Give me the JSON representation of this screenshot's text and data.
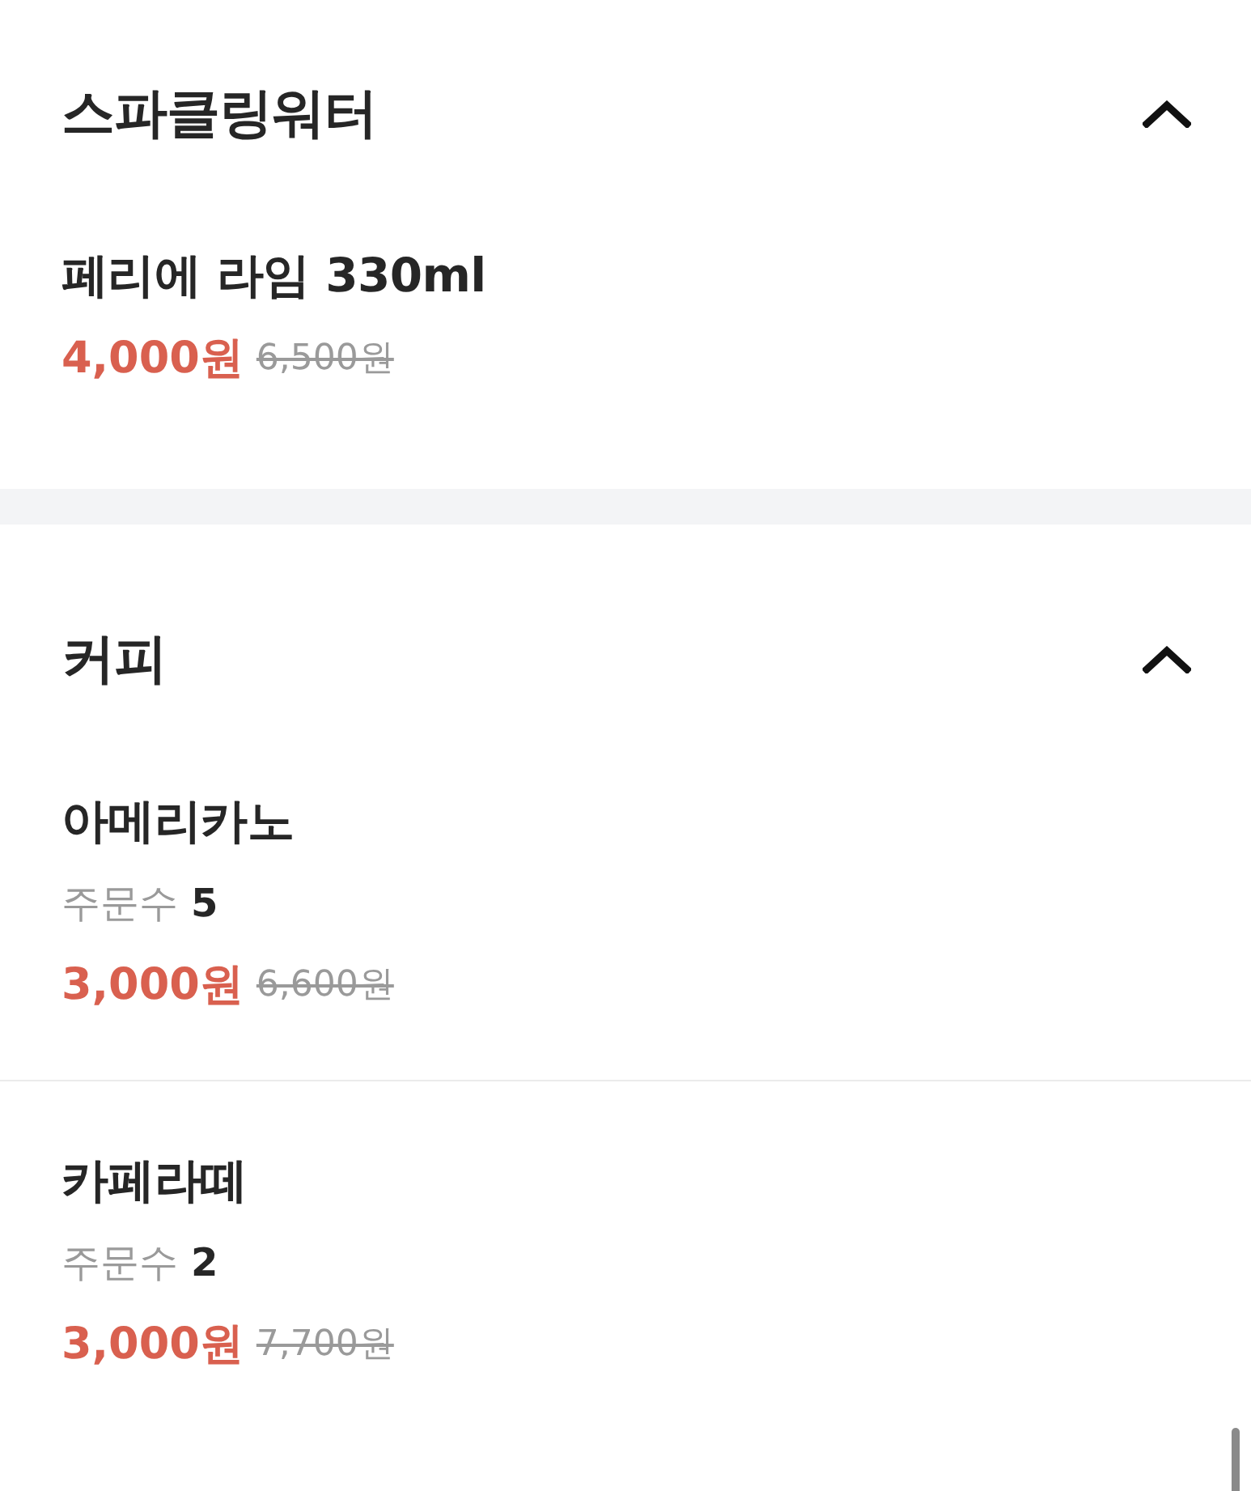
{
  "sections": [
    {
      "title": "스파클링워터",
      "expanded": true,
      "items": [
        {
          "name": "페리에 라임 330ml",
          "price": "4,000원",
          "original_price": "6,500원"
        }
      ]
    },
    {
      "title": "커피",
      "expanded": true,
      "items": [
        {
          "name": "아메리카노",
          "order_count_label": "주문수",
          "order_count": "5",
          "price": "3,000원",
          "original_price": "6,600원"
        },
        {
          "name": "카페라떼",
          "order_count_label": "주문수",
          "order_count": "2",
          "price": "3,000원",
          "original_price": "7,700원"
        }
      ]
    }
  ]
}
